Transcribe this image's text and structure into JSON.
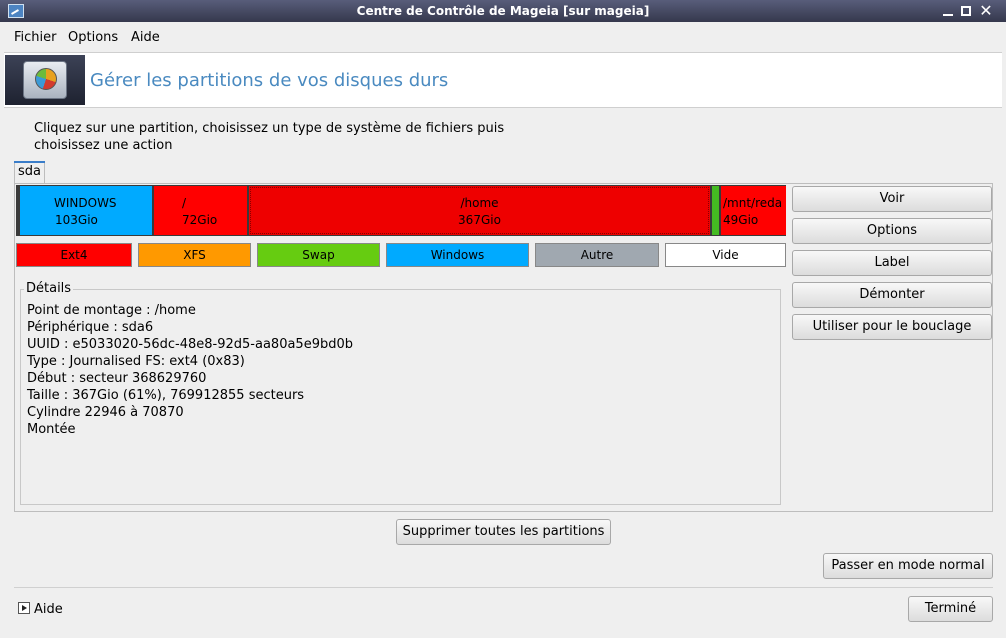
{
  "window": {
    "title": "Centre de Contrôle de Mageia  [sur mageia]",
    "minimize_glyph": "_",
    "maximize_glyph": "□",
    "close_glyph": "✕"
  },
  "menubar": {
    "items": [
      "Fichier",
      "Options",
      "Aide"
    ]
  },
  "header": {
    "title": "Gérer les partitions de vos disques durs"
  },
  "instructions": [
    "Cliquez sur une partition, choisissez un type de système de fichiers puis",
    "choisissez une action"
  ],
  "disk_tab": {
    "label": "sda"
  },
  "partitions": [
    {
      "name": "WINDOWS",
      "size": "103Gio",
      "type": "Windows",
      "color": "#00aaff"
    },
    {
      "name": "/",
      "size": "72Gio",
      "type": "Ext4",
      "color": "#ff0000"
    },
    {
      "name": "/home",
      "size": "367Gio",
      "type": "Ext4",
      "color": "#ee0000",
      "selected": true
    },
    {
      "name": "",
      "size": "",
      "type": "Swap",
      "color": "#44bb22"
    },
    {
      "name": "/mnt/reda",
      "size": "49Gio",
      "type": "Ext4",
      "color": "#ff0000"
    }
  ],
  "legend": [
    {
      "label": "Ext4",
      "color": "#ff0000"
    },
    {
      "label": "XFS",
      "color": "#ff9900"
    },
    {
      "label": "Swap",
      "color": "#66cc11"
    },
    {
      "label": "Windows",
      "color": "#00aaff"
    },
    {
      "label": "Autre",
      "color": "#a0a8b0"
    },
    {
      "label": "Vide",
      "color": "#ffffff"
    }
  ],
  "details": {
    "label": "Détails",
    "lines": [
      "Point de montage : /home",
      "Périphérique : sda6",
      "UUID : e5033020-56dc-48e8-92d5-aa80a5e9bd0b",
      "Type : Journalised FS: ext4 (0x83)",
      "Début : secteur 368629760",
      "Taille : 367Gio (61%), 769912855 secteurs",
      "Cylindre 22946 à 70870",
      "Montée"
    ]
  },
  "actions": [
    "Voir",
    "Options",
    "Label",
    "Démonter",
    "Utiliser pour le bouclage"
  ],
  "buttons": {
    "delete_all": "Supprimer toutes les partitions",
    "normal_mode": "Passer en mode normal",
    "done": "Terminé",
    "help": "Aide"
  }
}
